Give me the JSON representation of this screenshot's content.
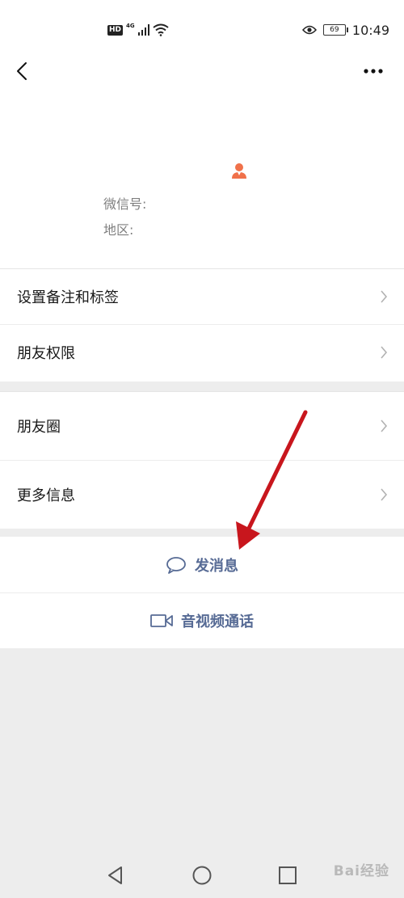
{
  "status_bar": {
    "hd_label": "HD",
    "network_label": "4G",
    "battery_level": "69",
    "time": "10:49"
  },
  "profile": {
    "wechat_id_label": "微信号:",
    "region_label": "地区:"
  },
  "settings_group": [
    {
      "label": "设置备注和标签"
    },
    {
      "label": "朋友权限"
    }
  ],
  "info_group": [
    {
      "label": "朋友圈"
    },
    {
      "label": "更多信息"
    }
  ],
  "actions": {
    "send_message": "发消息",
    "video_call": "音视频通话"
  },
  "watermark": "Bai经验",
  "colors": {
    "link_blue": "#576b95",
    "background": "#ededed",
    "avatar_orange": "#f0714a",
    "annotation_red": "#c8161d"
  }
}
